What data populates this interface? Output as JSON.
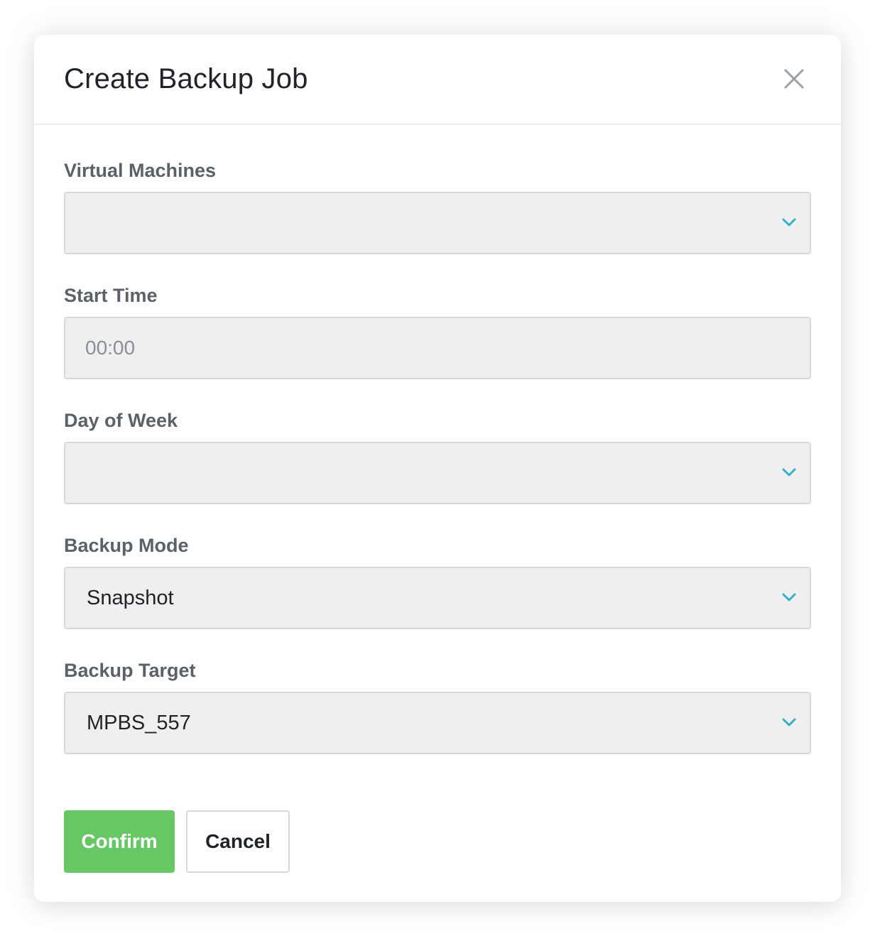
{
  "dialog": {
    "title": "Create Backup Job",
    "close_icon": "close-icon"
  },
  "form": {
    "virtual_machines": {
      "label": "Virtual Machines",
      "value": ""
    },
    "start_time": {
      "label": "Start Time",
      "placeholder": "00:00",
      "value": ""
    },
    "day_of_week": {
      "label": "Day of Week",
      "value": ""
    },
    "backup_mode": {
      "label": "Backup Mode",
      "value": "Snapshot"
    },
    "backup_target": {
      "label": "Backup Target",
      "value": "MPBS_557"
    }
  },
  "actions": {
    "confirm_label": "Confirm",
    "cancel_label": "Cancel"
  },
  "colors": {
    "accent_chevron": "#2fb3c8",
    "confirm_bg": "#65c863",
    "field_bg": "#efefef",
    "label_text": "#5c6169"
  }
}
